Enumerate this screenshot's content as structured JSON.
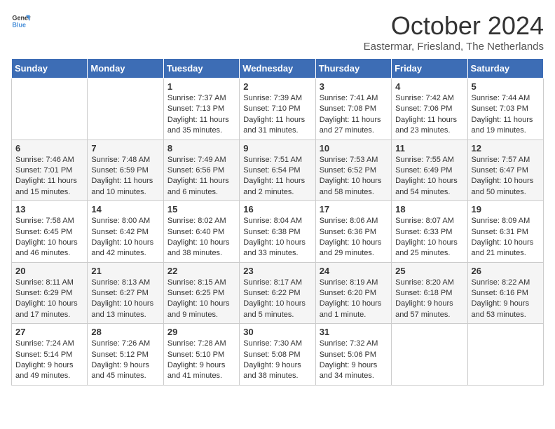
{
  "header": {
    "logo_general": "General",
    "logo_blue": "Blue",
    "month_title": "October 2024",
    "subtitle": "Eastermar, Friesland, The Netherlands"
  },
  "weekdays": [
    "Sunday",
    "Monday",
    "Tuesday",
    "Wednesday",
    "Thursday",
    "Friday",
    "Saturday"
  ],
  "weeks": [
    [
      {
        "day": "",
        "info": ""
      },
      {
        "day": "",
        "info": ""
      },
      {
        "day": "1",
        "info": "Sunrise: 7:37 AM\nSunset: 7:13 PM\nDaylight: 11 hours and 35 minutes."
      },
      {
        "day": "2",
        "info": "Sunrise: 7:39 AM\nSunset: 7:10 PM\nDaylight: 11 hours and 31 minutes."
      },
      {
        "day": "3",
        "info": "Sunrise: 7:41 AM\nSunset: 7:08 PM\nDaylight: 11 hours and 27 minutes."
      },
      {
        "day": "4",
        "info": "Sunrise: 7:42 AM\nSunset: 7:06 PM\nDaylight: 11 hours and 23 minutes."
      },
      {
        "day": "5",
        "info": "Sunrise: 7:44 AM\nSunset: 7:03 PM\nDaylight: 11 hours and 19 minutes."
      }
    ],
    [
      {
        "day": "6",
        "info": "Sunrise: 7:46 AM\nSunset: 7:01 PM\nDaylight: 11 hours and 15 minutes."
      },
      {
        "day": "7",
        "info": "Sunrise: 7:48 AM\nSunset: 6:59 PM\nDaylight: 11 hours and 10 minutes."
      },
      {
        "day": "8",
        "info": "Sunrise: 7:49 AM\nSunset: 6:56 PM\nDaylight: 11 hours and 6 minutes."
      },
      {
        "day": "9",
        "info": "Sunrise: 7:51 AM\nSunset: 6:54 PM\nDaylight: 11 hours and 2 minutes."
      },
      {
        "day": "10",
        "info": "Sunrise: 7:53 AM\nSunset: 6:52 PM\nDaylight: 10 hours and 58 minutes."
      },
      {
        "day": "11",
        "info": "Sunrise: 7:55 AM\nSunset: 6:49 PM\nDaylight: 10 hours and 54 minutes."
      },
      {
        "day": "12",
        "info": "Sunrise: 7:57 AM\nSunset: 6:47 PM\nDaylight: 10 hours and 50 minutes."
      }
    ],
    [
      {
        "day": "13",
        "info": "Sunrise: 7:58 AM\nSunset: 6:45 PM\nDaylight: 10 hours and 46 minutes."
      },
      {
        "day": "14",
        "info": "Sunrise: 8:00 AM\nSunset: 6:42 PM\nDaylight: 10 hours and 42 minutes."
      },
      {
        "day": "15",
        "info": "Sunrise: 8:02 AM\nSunset: 6:40 PM\nDaylight: 10 hours and 38 minutes."
      },
      {
        "day": "16",
        "info": "Sunrise: 8:04 AM\nSunset: 6:38 PM\nDaylight: 10 hours and 33 minutes."
      },
      {
        "day": "17",
        "info": "Sunrise: 8:06 AM\nSunset: 6:36 PM\nDaylight: 10 hours and 29 minutes."
      },
      {
        "day": "18",
        "info": "Sunrise: 8:07 AM\nSunset: 6:33 PM\nDaylight: 10 hours and 25 minutes."
      },
      {
        "day": "19",
        "info": "Sunrise: 8:09 AM\nSunset: 6:31 PM\nDaylight: 10 hours and 21 minutes."
      }
    ],
    [
      {
        "day": "20",
        "info": "Sunrise: 8:11 AM\nSunset: 6:29 PM\nDaylight: 10 hours and 17 minutes."
      },
      {
        "day": "21",
        "info": "Sunrise: 8:13 AM\nSunset: 6:27 PM\nDaylight: 10 hours and 13 minutes."
      },
      {
        "day": "22",
        "info": "Sunrise: 8:15 AM\nSunset: 6:25 PM\nDaylight: 10 hours and 9 minutes."
      },
      {
        "day": "23",
        "info": "Sunrise: 8:17 AM\nSunset: 6:22 PM\nDaylight: 10 hours and 5 minutes."
      },
      {
        "day": "24",
        "info": "Sunrise: 8:19 AM\nSunset: 6:20 PM\nDaylight: 10 hours and 1 minute."
      },
      {
        "day": "25",
        "info": "Sunrise: 8:20 AM\nSunset: 6:18 PM\nDaylight: 9 hours and 57 minutes."
      },
      {
        "day": "26",
        "info": "Sunrise: 8:22 AM\nSunset: 6:16 PM\nDaylight: 9 hours and 53 minutes."
      }
    ],
    [
      {
        "day": "27",
        "info": "Sunrise: 7:24 AM\nSunset: 5:14 PM\nDaylight: 9 hours and 49 minutes."
      },
      {
        "day": "28",
        "info": "Sunrise: 7:26 AM\nSunset: 5:12 PM\nDaylight: 9 hours and 45 minutes."
      },
      {
        "day": "29",
        "info": "Sunrise: 7:28 AM\nSunset: 5:10 PM\nDaylight: 9 hours and 41 minutes."
      },
      {
        "day": "30",
        "info": "Sunrise: 7:30 AM\nSunset: 5:08 PM\nDaylight: 9 hours and 38 minutes."
      },
      {
        "day": "31",
        "info": "Sunrise: 7:32 AM\nSunset: 5:06 PM\nDaylight: 9 hours and 34 minutes."
      },
      {
        "day": "",
        "info": ""
      },
      {
        "day": "",
        "info": ""
      }
    ]
  ]
}
